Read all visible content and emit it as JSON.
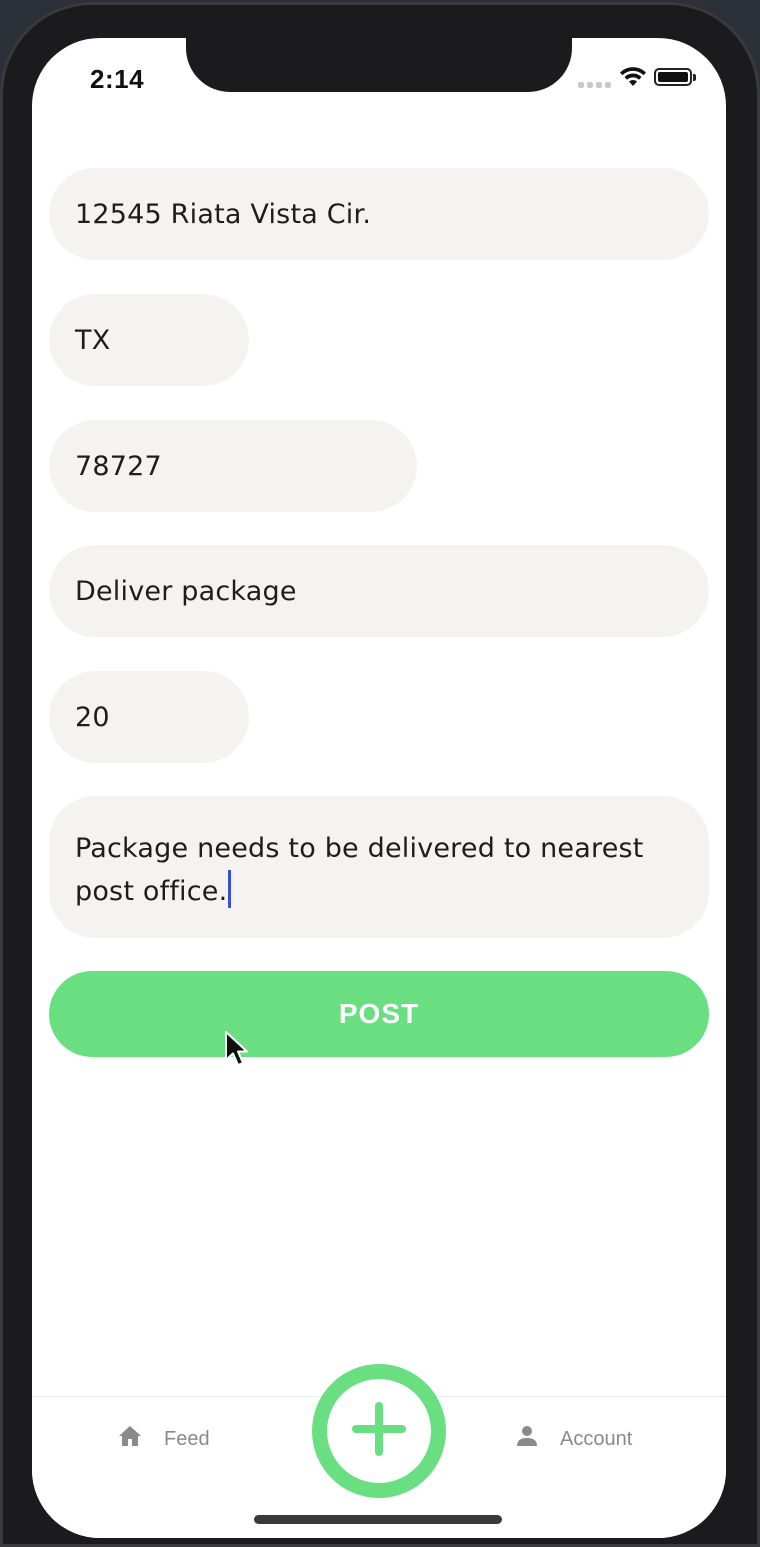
{
  "status_bar": {
    "time": "2:14"
  },
  "form": {
    "address": "12545 Riata Vista Cir.",
    "state": "TX",
    "zip": "78727",
    "title": "Deliver package",
    "price": "20",
    "description": "Package needs to be delivered to nearest post office."
  },
  "post_button": {
    "label": "POST"
  },
  "tab_bar": {
    "feed_label": "Feed",
    "account_label": "Account"
  },
  "colors": {
    "accent": "#69df82",
    "field_background": "#f5f3f2",
    "caret": "#3a4fd6"
  },
  "icons": {
    "feed": "home-icon",
    "add": "plus-icon",
    "account": "person-icon",
    "status": [
      "signal-icon",
      "wifi-icon",
      "battery-icon"
    ]
  }
}
